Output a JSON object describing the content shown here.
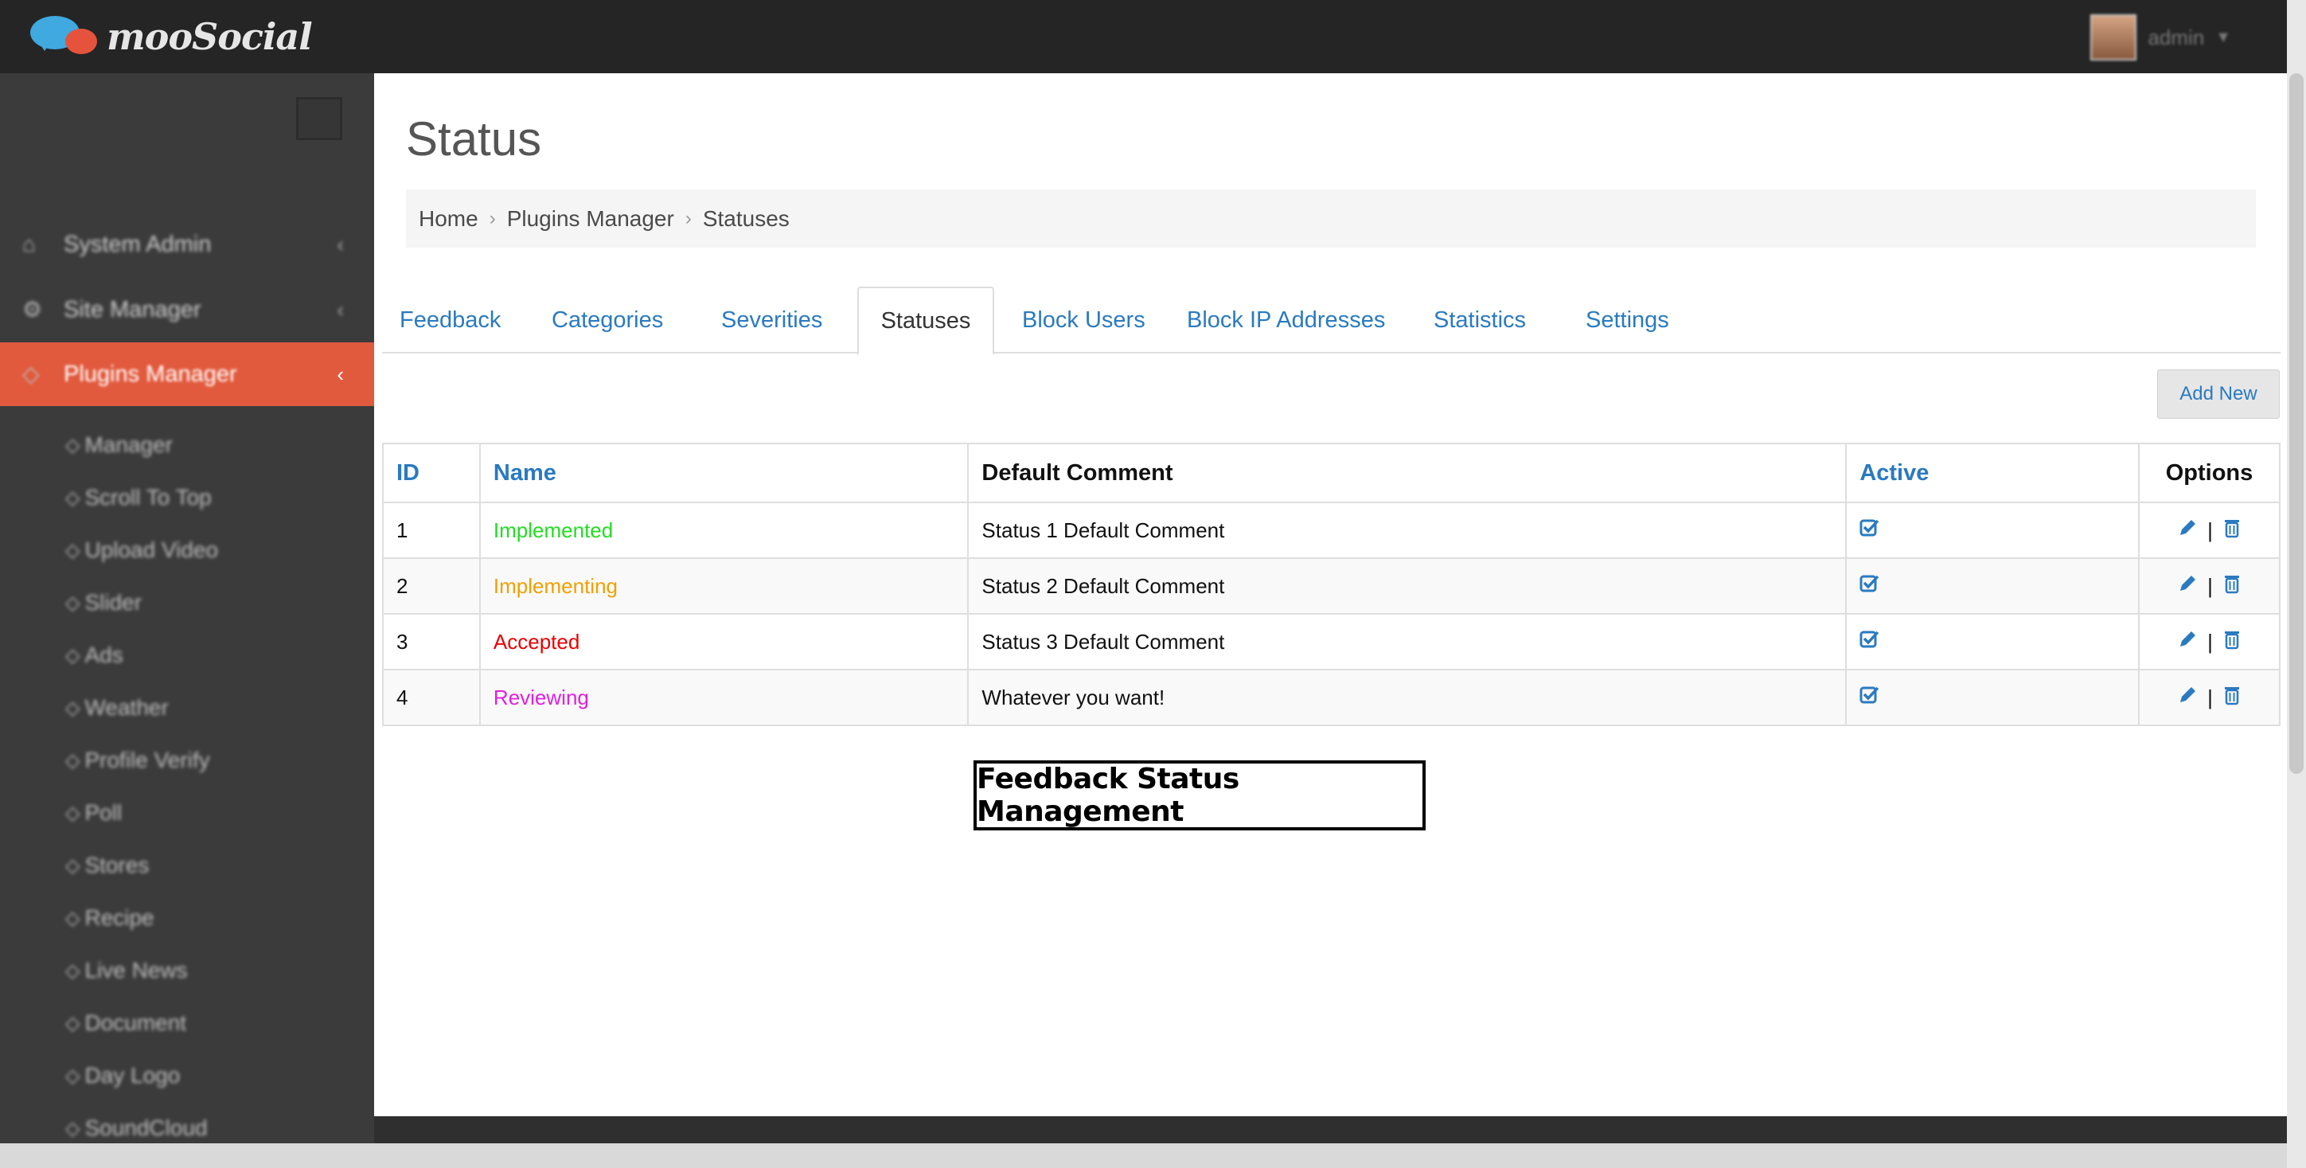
{
  "topbar": {
    "logo_text": "mooSocial",
    "user_name": "admin"
  },
  "sidebar": {
    "items": [
      {
        "label": "System Admin",
        "icon": "home-icon"
      },
      {
        "label": "Site Manager",
        "icon": "gears-icon"
      },
      {
        "label": "Plugins Manager",
        "icon": "tag-icon",
        "active": true
      }
    ],
    "sub_items": [
      "Manager",
      "Scroll To Top",
      "Upload Video",
      "Slider",
      "Ads",
      "Weather",
      "Profile Verify",
      "Poll",
      "Stores",
      "Recipe",
      "Live News",
      "Document",
      "Day Logo",
      "SoundCloud"
    ]
  },
  "page": {
    "title": "Status",
    "breadcrumb": [
      "Home",
      "Plugins Manager",
      "Statuses"
    ]
  },
  "tabs": [
    {
      "label": "Feedback"
    },
    {
      "label": "Categories"
    },
    {
      "label": "Severities"
    },
    {
      "label": "Statuses",
      "active": true
    },
    {
      "label": "Block Users"
    },
    {
      "label": "Block IP Addresses"
    },
    {
      "label": "Statistics"
    },
    {
      "label": "Settings"
    }
  ],
  "add_new_label": "Add New",
  "table": {
    "headers": {
      "id": "ID",
      "name": "Name",
      "comment": "Default Comment",
      "active": "Active",
      "options": "Options"
    },
    "rows": [
      {
        "id": "1",
        "name": "Implemented",
        "color": "#22dd22",
        "comment": "Status 1 Default Comment"
      },
      {
        "id": "2",
        "name": "Implementing",
        "color": "#f0a000",
        "comment": "Status 2 Default Comment"
      },
      {
        "id": "3",
        "name": "Accepted",
        "color": "#e80000",
        "comment": "Status 3 Default Comment"
      },
      {
        "id": "4",
        "name": "Reviewing",
        "color": "#e020e0",
        "comment": "Whatever you want!"
      }
    ],
    "option_separator": "|"
  },
  "caption": "Feedback Status Management",
  "colors": {
    "accent": "#2a7ac0",
    "sidebar_active": "#e25a3e"
  }
}
